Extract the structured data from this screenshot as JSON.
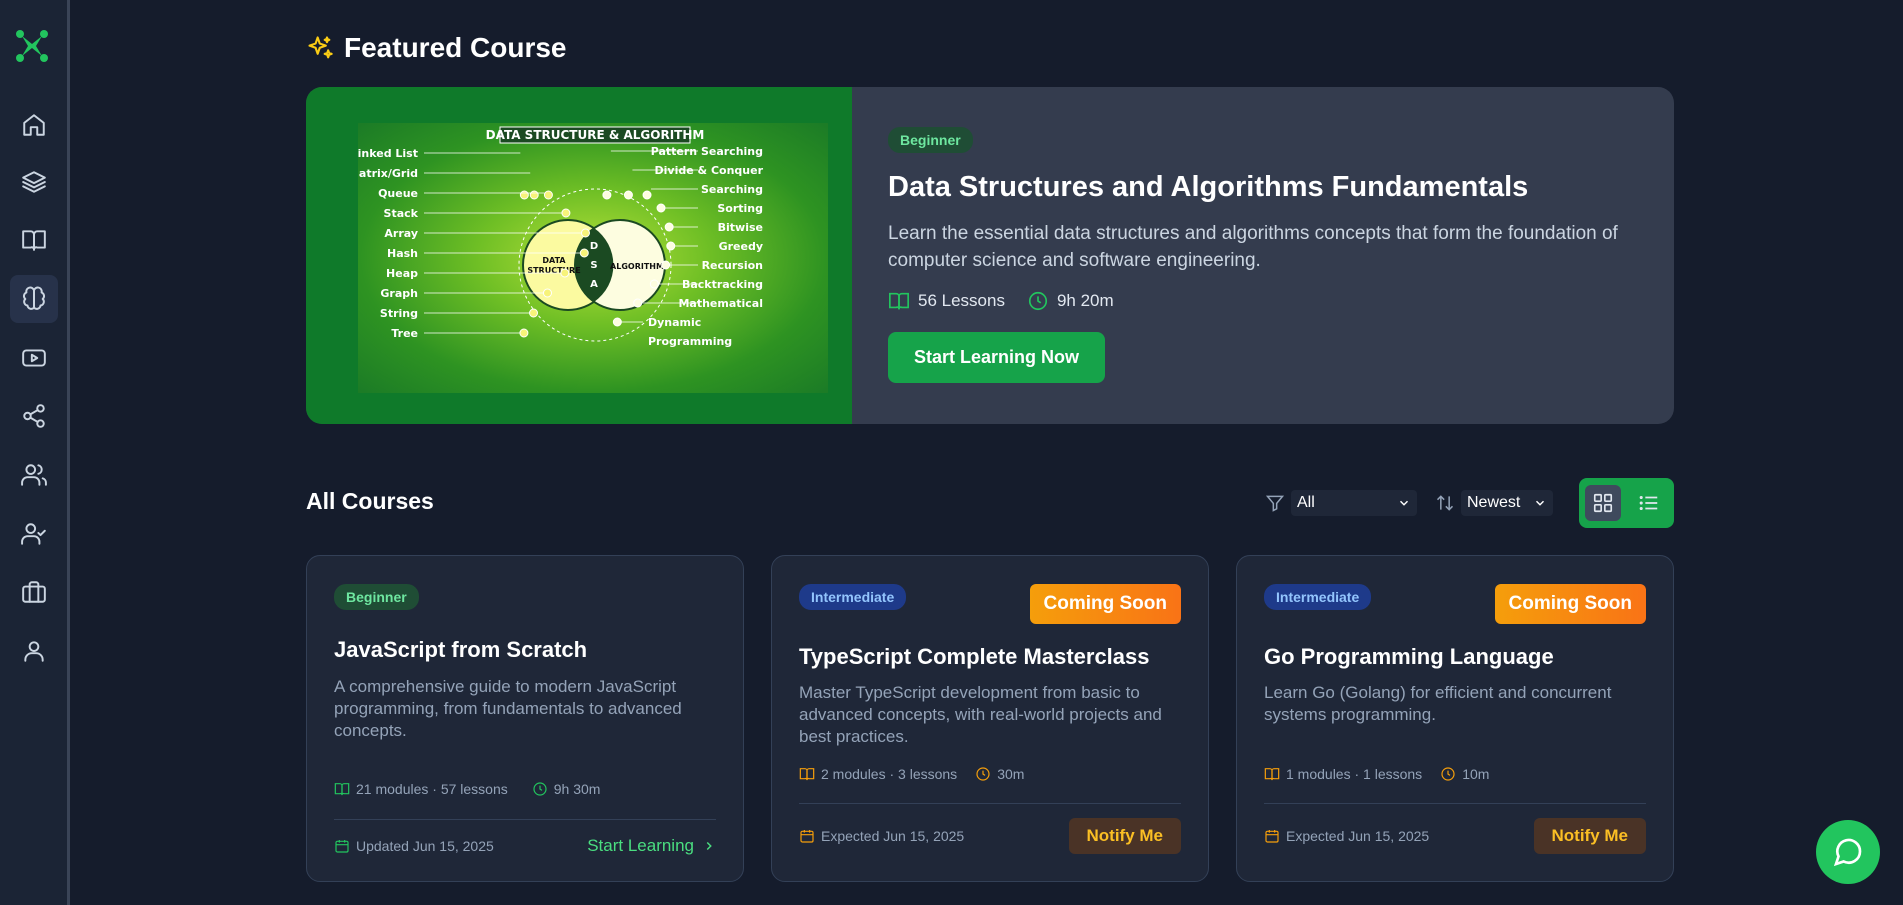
{
  "featured": {
    "section_title": "Featured Course",
    "image_title": "DATA STRUCTURE & ALGORITHM",
    "image_left_circle": "DATA STRUCTURE",
    "image_mid": "D S A",
    "image_right_circle": "ALGORITHM",
    "image_left_labels": [
      "Linked List",
      "Matrix/Grid",
      "Queue",
      "Stack",
      "Array",
      "Hash",
      "Heap",
      "Graph",
      "String",
      "Tree"
    ],
    "image_right_labels": [
      "Pattern Searching",
      "Divide & Conquer",
      "Searching",
      "Sorting",
      "Bitwise",
      "Greedy",
      "Recursion",
      "Backtracking",
      "Mathematical",
      "Dynamic",
      "Programming"
    ],
    "level": "Beginner",
    "title": "Data Structures and Algorithms Fundamentals",
    "description": "Learn the essential data structures and algorithms concepts that form the foundation of computer science and software engineering.",
    "lessons": "56 Lessons",
    "duration": "9h 20m",
    "cta": "Start Learning Now"
  },
  "all_courses": {
    "title": "All Courses",
    "filter_value": "All",
    "sort_value": "Newest"
  },
  "courses": [
    {
      "level": "Beginner",
      "title": "JavaScript from Scratch",
      "description": "A comprehensive guide to modern JavaScript programming, from fundamentals to advanced concepts.",
      "modules": "21 modules · 57 lessons",
      "duration": "9h 30m",
      "date": "Updated Jun 15, 2025",
      "action": "Start Learning"
    },
    {
      "level": "Intermediate",
      "status": "Coming Soon",
      "title": "TypeScript Complete Masterclass",
      "description": "Master TypeScript development from basic to advanced concepts, with real-world projects and best practices.",
      "modules": "2 modules · 3 lessons",
      "duration": "30m",
      "date": "Expected Jun 15, 2025",
      "action": "Notify Me"
    },
    {
      "level": "Intermediate",
      "status": "Coming Soon",
      "title": "Go Programming Language",
      "description": "Learn Go (Golang) for efficient and concurrent systems programming.",
      "modules": "1 modules · 1 lessons",
      "duration": "10m",
      "date": "Expected Jun 15, 2025",
      "action": "Notify Me"
    }
  ],
  "colors": {
    "accent": "#16a34a",
    "background": "#151c2c",
    "coming_soon": "#f59e0b"
  }
}
